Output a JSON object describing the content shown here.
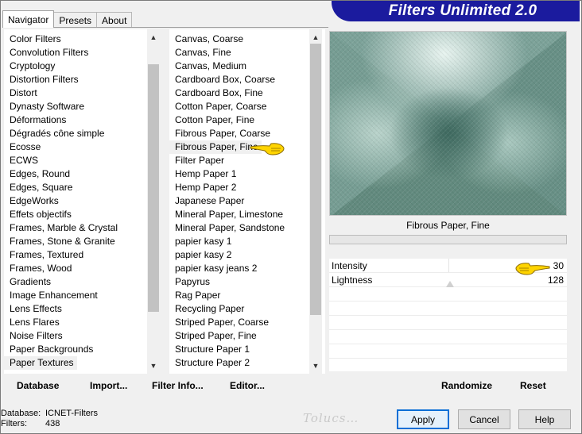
{
  "window": {
    "banner_title": "Filters Unlimited 2.0"
  },
  "tabs": [
    {
      "label": "Navigator",
      "active": true
    },
    {
      "label": "Presets",
      "active": false
    },
    {
      "label": "About",
      "active": false
    }
  ],
  "categories": {
    "items": [
      "Color Filters",
      "Convolution Filters",
      "Cryptology",
      "Distortion Filters",
      "Distort",
      "Dynasty Software",
      "Déformations",
      "Dégradés cône simple",
      "Ecosse",
      "ECWS",
      "Edges, Round",
      "Edges, Square",
      "EdgeWorks",
      "Effets objectifs",
      "Frames, Marble & Crystal",
      "Frames, Stone & Granite",
      "Frames, Textured",
      "Frames, Wood",
      "Gradients",
      "Image Enhancement",
      "Lens Effects",
      "Lens Flares",
      "Noise Filters",
      "Paper Backgrounds",
      "Paper Textures"
    ],
    "selected": "Paper Textures"
  },
  "filters": {
    "items": [
      "Canvas, Coarse",
      "Canvas, Fine",
      "Canvas, Medium",
      "Cardboard Box, Coarse",
      "Cardboard Box, Fine",
      "Cotton Paper, Coarse",
      "Cotton Paper, Fine",
      "Fibrous Paper, Coarse",
      "Fibrous Paper, Fine",
      "Filter Paper",
      "Hemp Paper 1",
      "Hemp Paper 2",
      "Japanese Paper",
      "Mineral Paper, Limestone",
      "Mineral Paper, Sandstone",
      "papier kasy 1",
      "papier kasy 2",
      "papier kasy jeans 2",
      "Papyrus",
      "Rag Paper",
      "Recycling Paper",
      "Striped Paper, Coarse",
      "Striped Paper, Fine",
      "Structure Paper 1",
      "Structure Paper 2"
    ],
    "selected": "Fibrous Paper, Fine"
  },
  "preview": {
    "filter_name": "Fibrous Paper, Fine",
    "progress": 0
  },
  "parameters": [
    {
      "name": "Intensity",
      "value": "30"
    },
    {
      "name": "Lightness",
      "value": "128"
    }
  ],
  "actions": {
    "database": "Database",
    "import": "Import...",
    "filter_info": "Filter Info...",
    "editor": "Editor...",
    "randomize": "Randomize",
    "reset": "Reset"
  },
  "status": {
    "database_label": "Database:",
    "database_value": "ICNET-Filters",
    "filters_label": "Filters:",
    "filters_value": "438"
  },
  "dialog_buttons": {
    "apply": "Apply",
    "cancel": "Cancel",
    "help": "Help"
  },
  "colors": {
    "banner": "#1b1b9e",
    "preview_base": "#6f968c",
    "default_button_border": "#0a6fd6",
    "hand_fill": "#ffd400"
  }
}
